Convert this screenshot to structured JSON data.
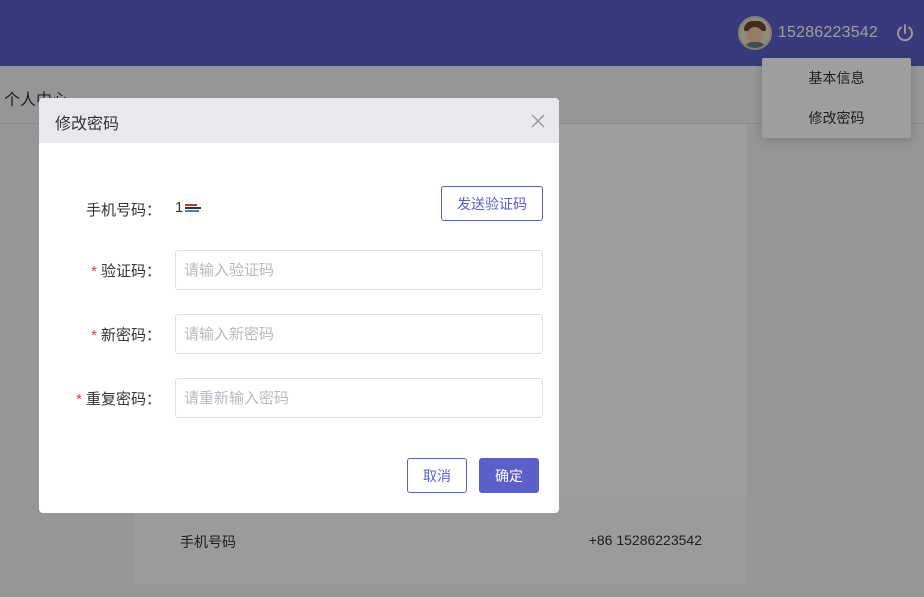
{
  "header": {
    "username": "15286223542",
    "avatar_icon": "user-avatar-icon",
    "logout_icon": "power-icon",
    "accent_color": "#5b5fc7"
  },
  "dropdown": {
    "items": [
      {
        "label": "基本信息"
      },
      {
        "label": "修改密码"
      }
    ]
  },
  "page": {
    "title": "个人中心",
    "info": {
      "phone_label": "手机号码",
      "phone_value": "+86 15286223542"
    }
  },
  "modal": {
    "title": "修改密码",
    "close_icon": "close-icon",
    "phone_label": "手机号码：",
    "phone_value": "1",
    "send_code_label": "发送验证码",
    "code_label": "验证码：",
    "code_placeholder": "请输入验证码",
    "new_password_label": "新密码：",
    "new_password_placeholder": "请输入新密码",
    "repeat_password_label": "重复密码：",
    "repeat_password_placeholder": "请重新输入密码",
    "required_mark": "*",
    "cancel_label": "取消",
    "confirm_label": "确定"
  }
}
